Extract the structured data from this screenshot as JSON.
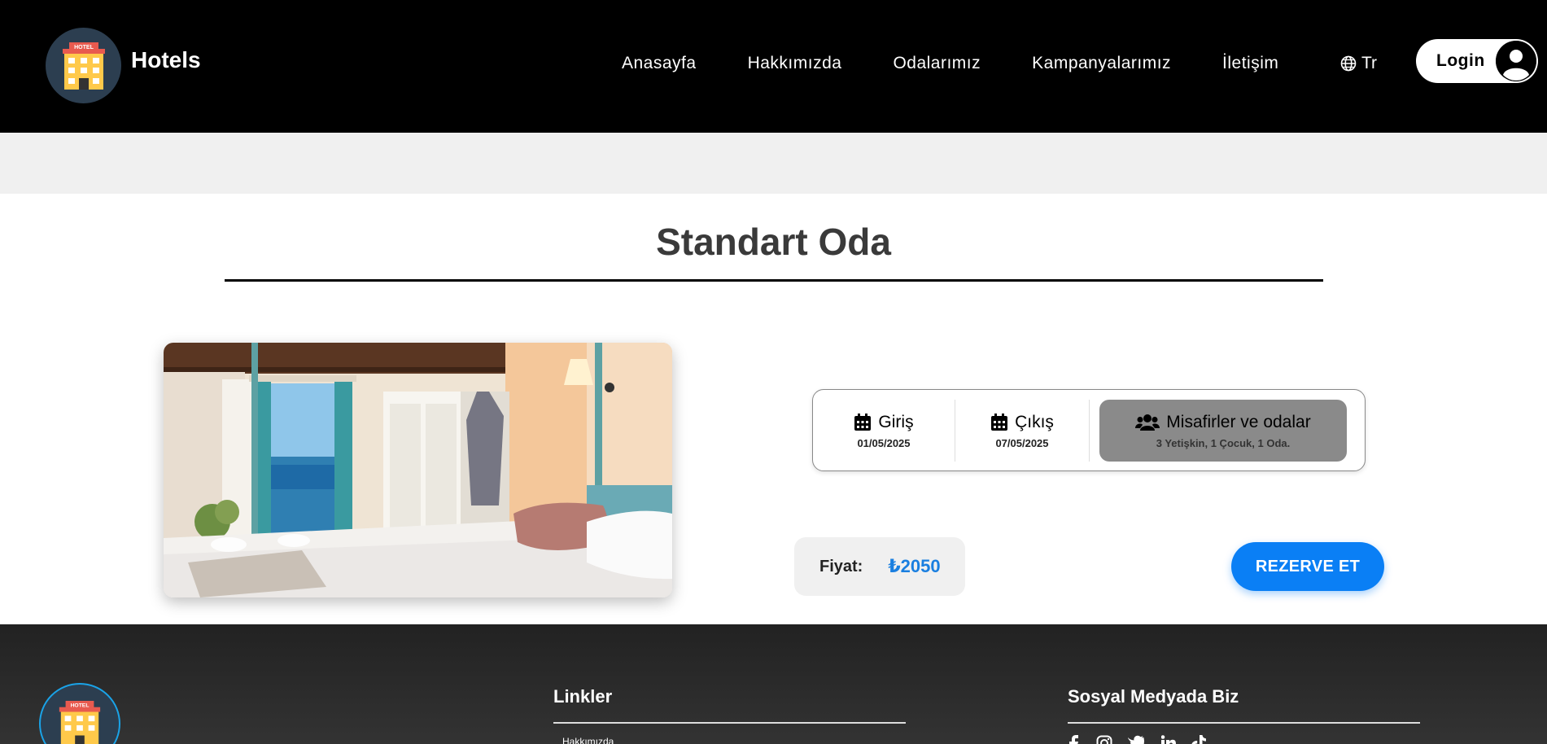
{
  "header": {
    "brand": "Hotels",
    "nav": [
      "Anasayfa",
      "Hakkımızda",
      "Odalarımız",
      "Kampanyalarımız",
      "İletişim"
    ],
    "language": "Tr",
    "login_label": "Login"
  },
  "room": {
    "title": "Standart Oda"
  },
  "booking": {
    "checkin_label": "Giriş",
    "checkin_date": "01/05/2025",
    "checkout_label": "Çıkış",
    "checkout_date": "07/05/2025",
    "guests_label": "Misafirler ve odalar",
    "guests_value": "3 Yetişkin, 1 Çocuk, 1 Oda."
  },
  "price": {
    "label": "Fiyat:",
    "value": "₺2050"
  },
  "reserve_label": "REZERVE ET",
  "footer": {
    "links_title": "Linkler",
    "links": [
      "Hakkımızda"
    ],
    "social_title": "Sosyal Medyada Biz",
    "social_icons": [
      "facebook-icon",
      "instagram-icon",
      "twitter-icon",
      "linkedin-icon",
      "tiktok-icon"
    ]
  },
  "colors": {
    "accent": "#0a7ff5",
    "price": "#1a7fe0",
    "header_bg": "#000000",
    "footer_bg": "#2a2a2a"
  }
}
